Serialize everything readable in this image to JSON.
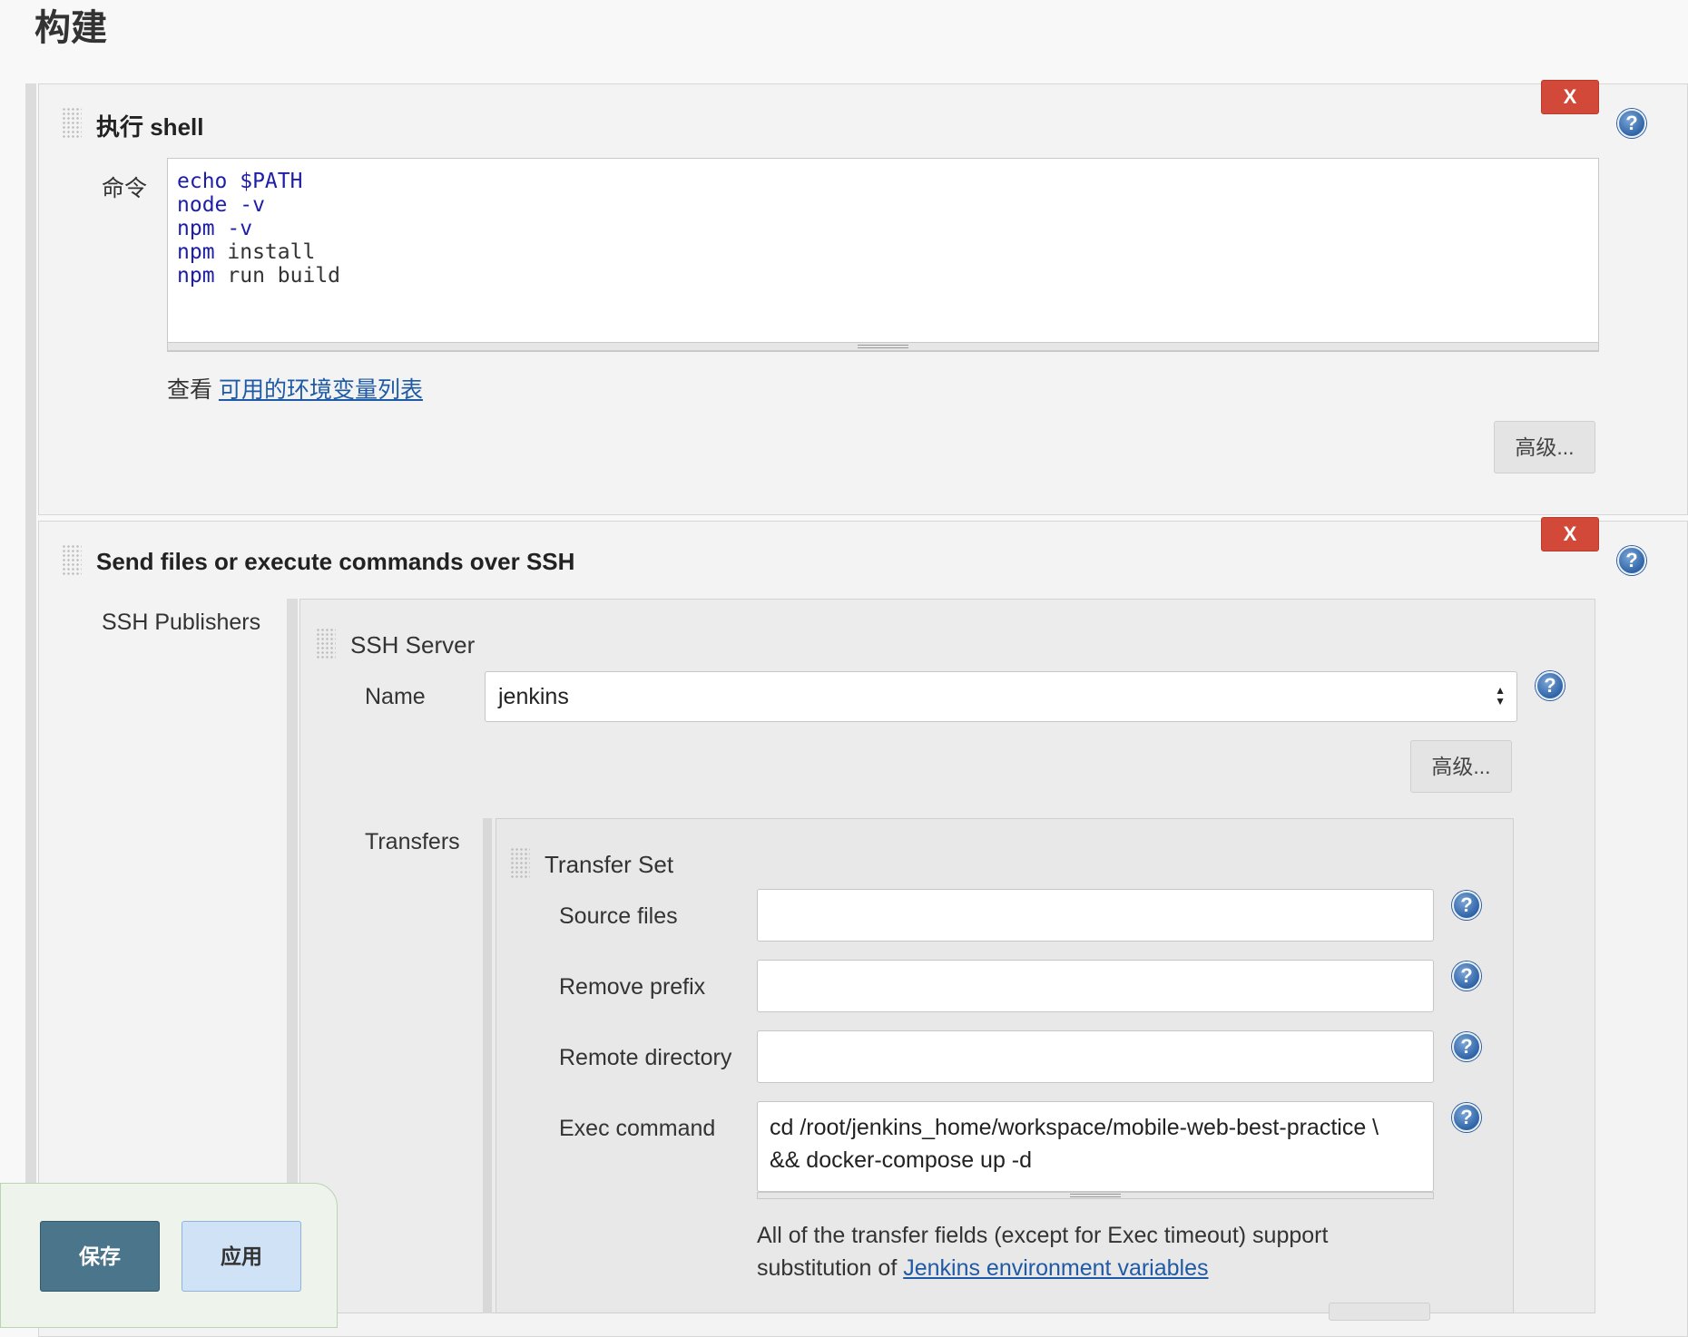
{
  "section": {
    "title": "构建"
  },
  "shell_step": {
    "title": "执行 shell",
    "command_label": "命令",
    "command_lines": [
      {
        "kw": "echo",
        "rest": " $PATH",
        "rest_kw": true
      },
      {
        "kw": "node",
        "rest": " -v",
        "rest_kw": true
      },
      {
        "kw": "npm",
        "rest": " -v",
        "rest_kw": true
      },
      {
        "kw": "npm",
        "rest": " install",
        "rest_kw": false
      },
      {
        "kw": "npm",
        "rest": " run build",
        "rest_kw": false
      }
    ],
    "env_prefix": "查看 ",
    "env_link": "可用的环境变量列表",
    "advanced_label": "高级...",
    "delete_label": "X"
  },
  "ssh_step": {
    "title": "Send files or execute commands over SSH",
    "delete_label": "X",
    "publishers_label": "SSH Publishers",
    "server": {
      "title": "SSH Server",
      "name_label": "Name",
      "name_value": "jenkins",
      "advanced_label": "高级..."
    },
    "transfers": {
      "label": "Transfers",
      "set_title": "Transfer Set",
      "source_files_label": "Source files",
      "source_files_value": "",
      "remove_prefix_label": "Remove prefix",
      "remove_prefix_value": "",
      "remote_directory_label": "Remote directory",
      "remote_directory_value": "",
      "exec_command_label": "Exec command",
      "exec_command_line1": "cd /root/jenkins_home/workspace/mobile-web-best-practice \\",
      "exec_command_line2": "&& docker-compose up -d",
      "note_line1": "All of the transfer fields (except for Exec timeout) support",
      "note_line2_prefix": "substitution of ",
      "note_link": "Jenkins environment variables"
    }
  },
  "footer": {
    "save_label": "保存",
    "apply_label": "应用"
  },
  "icons": {
    "help": "help-icon",
    "grip": "drag-handle-icon",
    "select": "select-arrows-icon"
  },
  "colors": {
    "delete": "#d24939",
    "save": "#4b758b",
    "apply": "#d0e2f5",
    "link": "#1f5aa6"
  }
}
